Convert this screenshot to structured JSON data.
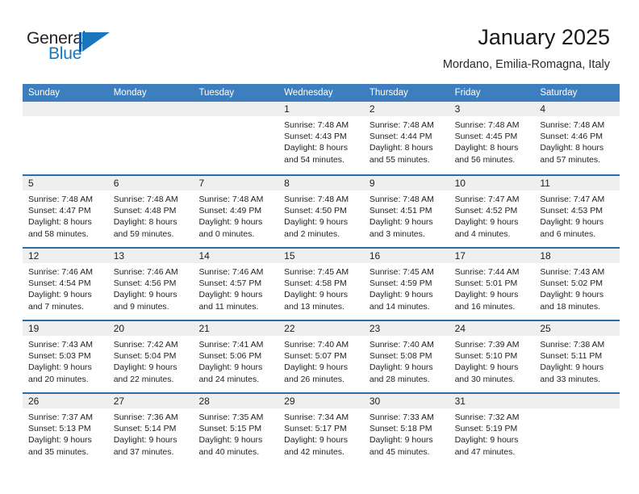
{
  "brand": {
    "name_part1": "General",
    "name_part2": "Blue",
    "logo_icon": "general-blue-triangle-logo",
    "accent_color": "#1a76bc"
  },
  "header": {
    "title": "January 2025",
    "subtitle": "Mordano, Emilia-Romagna, Italy"
  },
  "theme": {
    "header_bar_color": "#3c7ebe",
    "row_divider_color": "#2e6da4",
    "day_number_band_color": "#efefef"
  },
  "calendar": {
    "weekdays": [
      "Sunday",
      "Monday",
      "Tuesday",
      "Wednesday",
      "Thursday",
      "Friday",
      "Saturday"
    ],
    "weeks": [
      [
        {
          "day": "",
          "lines": []
        },
        {
          "day": "",
          "lines": []
        },
        {
          "day": "",
          "lines": []
        },
        {
          "day": "1",
          "lines": [
            "Sunrise: 7:48 AM",
            "Sunset: 4:43 PM",
            "Daylight: 8 hours",
            "and 54 minutes."
          ]
        },
        {
          "day": "2",
          "lines": [
            "Sunrise: 7:48 AM",
            "Sunset: 4:44 PM",
            "Daylight: 8 hours",
            "and 55 minutes."
          ]
        },
        {
          "day": "3",
          "lines": [
            "Sunrise: 7:48 AM",
            "Sunset: 4:45 PM",
            "Daylight: 8 hours",
            "and 56 minutes."
          ]
        },
        {
          "day": "4",
          "lines": [
            "Sunrise: 7:48 AM",
            "Sunset: 4:46 PM",
            "Daylight: 8 hours",
            "and 57 minutes."
          ]
        }
      ],
      [
        {
          "day": "5",
          "lines": [
            "Sunrise: 7:48 AM",
            "Sunset: 4:47 PM",
            "Daylight: 8 hours",
            "and 58 minutes."
          ]
        },
        {
          "day": "6",
          "lines": [
            "Sunrise: 7:48 AM",
            "Sunset: 4:48 PM",
            "Daylight: 8 hours",
            "and 59 minutes."
          ]
        },
        {
          "day": "7",
          "lines": [
            "Sunrise: 7:48 AM",
            "Sunset: 4:49 PM",
            "Daylight: 9 hours",
            "and 0 minutes."
          ]
        },
        {
          "day": "8",
          "lines": [
            "Sunrise: 7:48 AM",
            "Sunset: 4:50 PM",
            "Daylight: 9 hours",
            "and 2 minutes."
          ]
        },
        {
          "day": "9",
          "lines": [
            "Sunrise: 7:48 AM",
            "Sunset: 4:51 PM",
            "Daylight: 9 hours",
            "and 3 minutes."
          ]
        },
        {
          "day": "10",
          "lines": [
            "Sunrise: 7:47 AM",
            "Sunset: 4:52 PM",
            "Daylight: 9 hours",
            "and 4 minutes."
          ]
        },
        {
          "day": "11",
          "lines": [
            "Sunrise: 7:47 AM",
            "Sunset: 4:53 PM",
            "Daylight: 9 hours",
            "and 6 minutes."
          ]
        }
      ],
      [
        {
          "day": "12",
          "lines": [
            "Sunrise: 7:46 AM",
            "Sunset: 4:54 PM",
            "Daylight: 9 hours",
            "and 7 minutes."
          ]
        },
        {
          "day": "13",
          "lines": [
            "Sunrise: 7:46 AM",
            "Sunset: 4:56 PM",
            "Daylight: 9 hours",
            "and 9 minutes."
          ]
        },
        {
          "day": "14",
          "lines": [
            "Sunrise: 7:46 AM",
            "Sunset: 4:57 PM",
            "Daylight: 9 hours",
            "and 11 minutes."
          ]
        },
        {
          "day": "15",
          "lines": [
            "Sunrise: 7:45 AM",
            "Sunset: 4:58 PM",
            "Daylight: 9 hours",
            "and 13 minutes."
          ]
        },
        {
          "day": "16",
          "lines": [
            "Sunrise: 7:45 AM",
            "Sunset: 4:59 PM",
            "Daylight: 9 hours",
            "and 14 minutes."
          ]
        },
        {
          "day": "17",
          "lines": [
            "Sunrise: 7:44 AM",
            "Sunset: 5:01 PM",
            "Daylight: 9 hours",
            "and 16 minutes."
          ]
        },
        {
          "day": "18",
          "lines": [
            "Sunrise: 7:43 AM",
            "Sunset: 5:02 PM",
            "Daylight: 9 hours",
            "and 18 minutes."
          ]
        }
      ],
      [
        {
          "day": "19",
          "lines": [
            "Sunrise: 7:43 AM",
            "Sunset: 5:03 PM",
            "Daylight: 9 hours",
            "and 20 minutes."
          ]
        },
        {
          "day": "20",
          "lines": [
            "Sunrise: 7:42 AM",
            "Sunset: 5:04 PM",
            "Daylight: 9 hours",
            "and 22 minutes."
          ]
        },
        {
          "day": "21",
          "lines": [
            "Sunrise: 7:41 AM",
            "Sunset: 5:06 PM",
            "Daylight: 9 hours",
            "and 24 minutes."
          ]
        },
        {
          "day": "22",
          "lines": [
            "Sunrise: 7:40 AM",
            "Sunset: 5:07 PM",
            "Daylight: 9 hours",
            "and 26 minutes."
          ]
        },
        {
          "day": "23",
          "lines": [
            "Sunrise: 7:40 AM",
            "Sunset: 5:08 PM",
            "Daylight: 9 hours",
            "and 28 minutes."
          ]
        },
        {
          "day": "24",
          "lines": [
            "Sunrise: 7:39 AM",
            "Sunset: 5:10 PM",
            "Daylight: 9 hours",
            "and 30 minutes."
          ]
        },
        {
          "day": "25",
          "lines": [
            "Sunrise: 7:38 AM",
            "Sunset: 5:11 PM",
            "Daylight: 9 hours",
            "and 33 minutes."
          ]
        }
      ],
      [
        {
          "day": "26",
          "lines": [
            "Sunrise: 7:37 AM",
            "Sunset: 5:13 PM",
            "Daylight: 9 hours",
            "and 35 minutes."
          ]
        },
        {
          "day": "27",
          "lines": [
            "Sunrise: 7:36 AM",
            "Sunset: 5:14 PM",
            "Daylight: 9 hours",
            "and 37 minutes."
          ]
        },
        {
          "day": "28",
          "lines": [
            "Sunrise: 7:35 AM",
            "Sunset: 5:15 PM",
            "Daylight: 9 hours",
            "and 40 minutes."
          ]
        },
        {
          "day": "29",
          "lines": [
            "Sunrise: 7:34 AM",
            "Sunset: 5:17 PM",
            "Daylight: 9 hours",
            "and 42 minutes."
          ]
        },
        {
          "day": "30",
          "lines": [
            "Sunrise: 7:33 AM",
            "Sunset: 5:18 PM",
            "Daylight: 9 hours",
            "and 45 minutes."
          ]
        },
        {
          "day": "31",
          "lines": [
            "Sunrise: 7:32 AM",
            "Sunset: 5:19 PM",
            "Daylight: 9 hours",
            "and 47 minutes."
          ]
        },
        {
          "day": "",
          "lines": []
        }
      ]
    ]
  }
}
